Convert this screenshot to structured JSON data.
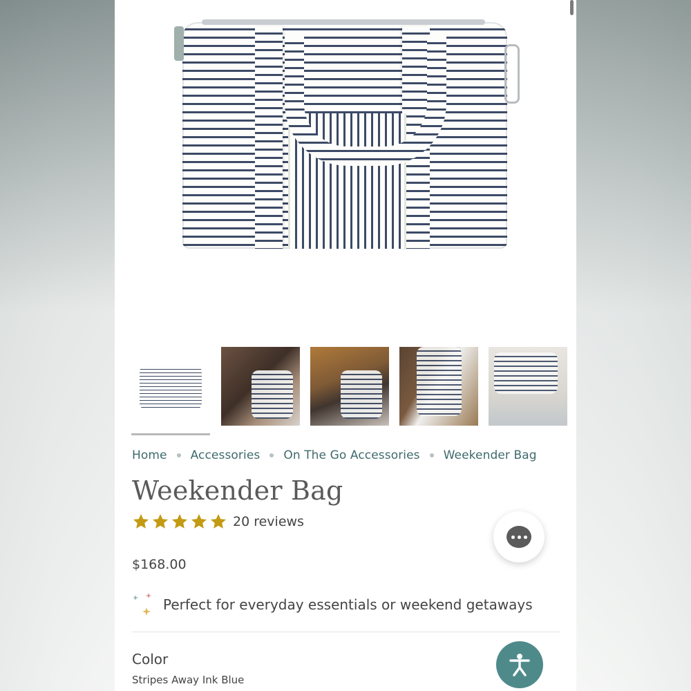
{
  "breadcrumb": {
    "items": [
      "Home",
      "Accessories",
      "On The Go Accessories",
      "Weekender Bag"
    ]
  },
  "product": {
    "title": "Weekender Bag",
    "rating": 5,
    "reviews_label": "20 reviews",
    "price": "$168.00",
    "tagline": "Perfect for everyday essentials or weekend getaways",
    "color_label": "Color",
    "color_value": "Stripes Away Ink Blue"
  },
  "gallery": {
    "thumbnail_count": 5,
    "selected_index": 0
  },
  "icons": {
    "star": "star-icon",
    "chat": "chat-icon",
    "accessibility": "accessibility-icon",
    "sparkle": "sparkle-icon"
  },
  "colors": {
    "accent_teal": "#3f6a6c",
    "star_gold": "#c39a12",
    "accessibility_bg": "#4f8a8b"
  }
}
